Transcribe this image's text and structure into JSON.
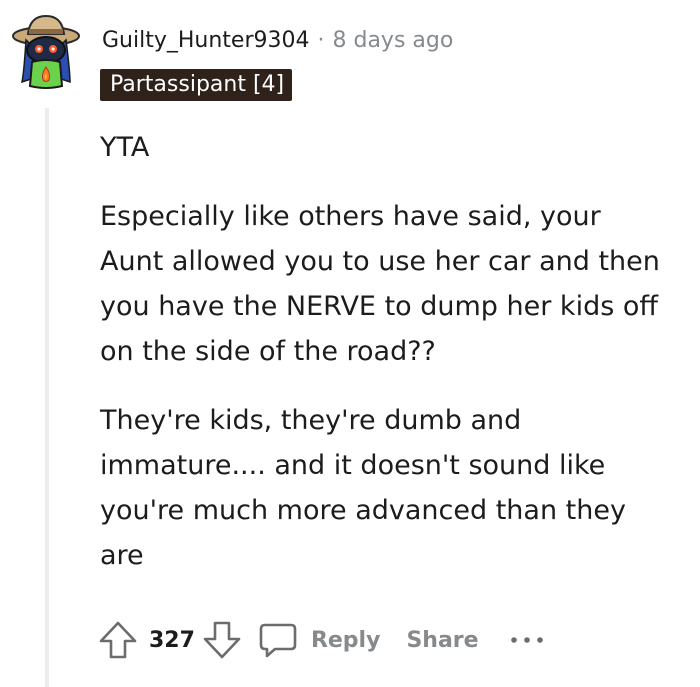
{
  "comment": {
    "username": "Guilty_Hunter9304",
    "separator": "·",
    "timestamp": "8 days ago",
    "flair": "Partassipant [4]",
    "paragraphs": [
      "YTA",
      "Especially like others have said, your Aunt allowed you to use her car and then you have the NERVE to dump her kids off on the side of the road??",
      "They're kids, they're dumb and immature.... and it doesn't sound like you're much more advanced than they are"
    ],
    "votes": "327",
    "reply_label": "Reply",
    "share_label": "Share"
  },
  "icons": {
    "avatar": "snoo-avatar-icon",
    "upvote": "upvote-arrow-icon",
    "downvote": "downvote-arrow-icon",
    "reply": "speech-bubble-icon",
    "more": "ellipsis-icon"
  },
  "colors": {
    "text": "#1c1c1c",
    "muted": "#878a8c",
    "flair_bg": "#2f221b",
    "flair_text": "#ffffff",
    "thread_line": "#ececec"
  }
}
